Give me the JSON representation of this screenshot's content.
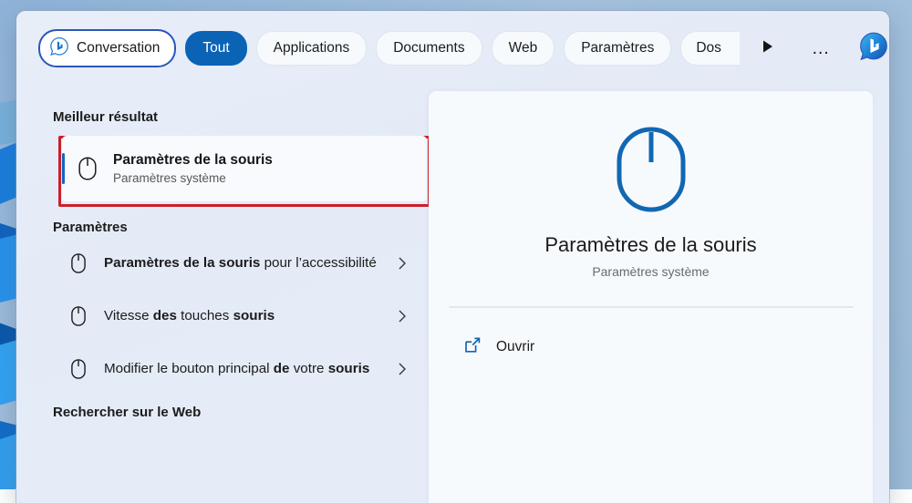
{
  "window": {
    "name": "windows-search-flyout"
  },
  "tabbar": {
    "conversation": {
      "label": "Conversation",
      "icon": "bing-chat-icon"
    },
    "tabs": [
      {
        "label": "Tout",
        "active": true
      },
      {
        "label": "Applications",
        "active": false
      },
      {
        "label": "Documents",
        "active": false
      },
      {
        "label": "Web",
        "active": false
      },
      {
        "label": "Paramètres",
        "active": false
      },
      {
        "label": "Dos",
        "active": false,
        "clipped": true
      }
    ],
    "scroll_next_icon": "play-triangle-icon",
    "overflow_label": "…",
    "avatar_icon": "bing-chat-avatar-icon",
    "active_pill_color": "#0a63b5",
    "conversation_border_color": "#2b56b8"
  },
  "results": {
    "best_heading": "Meilleur résultat",
    "best_result": {
      "title": "Paramètres de la souris",
      "subtitle": "Paramètres système",
      "icon": "mouse-icon",
      "annotation_color": "#cc1f28",
      "selection_color": "#1266c4"
    },
    "settings_heading": "Paramètres",
    "settings_items": [
      {
        "icon": "mouse-icon",
        "parts": [
          {
            "text": "Paramètres de la souris",
            "bold": true
          },
          {
            "text": " pour l’accessibilité",
            "bold": false
          }
        ],
        "chevron": "chevron-right-icon"
      },
      {
        "icon": "mouse-icon",
        "parts": [
          {
            "text": "Vitesse ",
            "bold": false
          },
          {
            "text": "des",
            "bold": true
          },
          {
            "text": " touches ",
            "bold": false
          },
          {
            "text": "souris",
            "bold": true
          }
        ],
        "chevron": "chevron-right-icon"
      },
      {
        "icon": "mouse-icon",
        "parts": [
          {
            "text": "Modifier le bouton principal ",
            "bold": false
          },
          {
            "text": "de",
            "bold": true
          },
          {
            "text": " votre ",
            "bold": false
          },
          {
            "text": "souris",
            "bold": true
          }
        ],
        "chevron": "chevron-right-icon"
      }
    ],
    "web_heading": "Rechercher sur le Web"
  },
  "preview": {
    "icon": "mouse-icon-large",
    "icon_color": "#1267b2",
    "title": "Paramètres de la souris",
    "subtitle": "Paramètres système",
    "open_action": {
      "label": "Ouvrir",
      "icon": "external-link-icon",
      "icon_color": "#1267b2"
    }
  }
}
